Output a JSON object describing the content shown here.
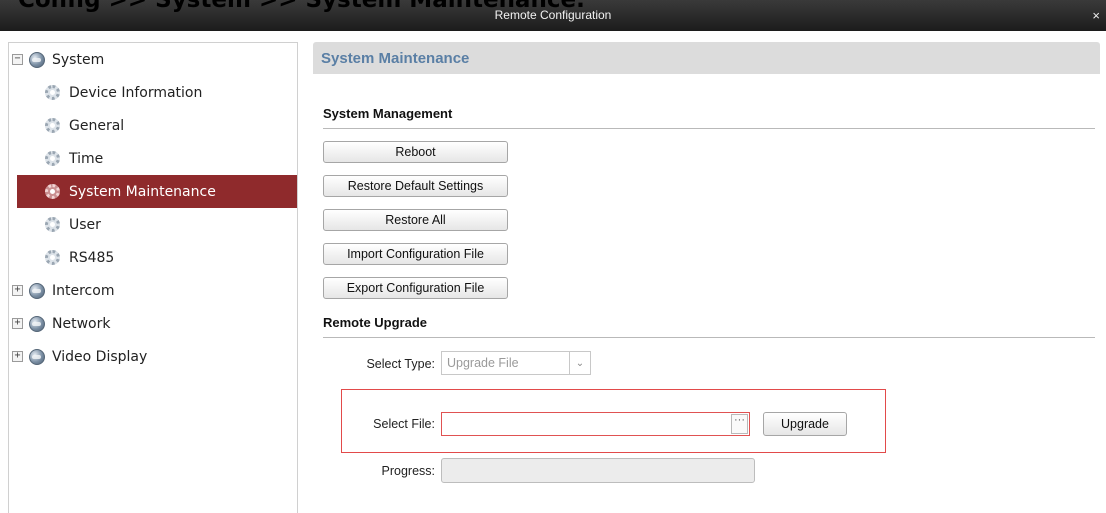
{
  "caption": "Config >> System >> System Maintenance.",
  "window": {
    "title": "Remote Configuration",
    "close_glyph": "×"
  },
  "sidebar": {
    "items": [
      {
        "label": "System",
        "level": 0,
        "toggle": "−",
        "icon": "globe-icon"
      },
      {
        "label": "Device Information",
        "level": 1,
        "icon": "gear-icon"
      },
      {
        "label": "General",
        "level": 1,
        "icon": "gear-icon"
      },
      {
        "label": "Time",
        "level": 1,
        "icon": "gear-icon"
      },
      {
        "label": "System Maintenance",
        "level": 1,
        "icon": "gear-icon",
        "selected": true
      },
      {
        "label": "User",
        "level": 1,
        "icon": "gear-icon"
      },
      {
        "label": "RS485",
        "level": 1,
        "icon": "gear-icon"
      },
      {
        "label": "Intercom",
        "level": 0,
        "toggle": "+",
        "icon": "globe-icon"
      },
      {
        "label": "Network",
        "level": 0,
        "toggle": "+",
        "icon": "globe-icon"
      },
      {
        "label": "Video Display",
        "level": 0,
        "toggle": "+",
        "icon": "globe-icon"
      }
    ]
  },
  "main": {
    "section_title": "System Maintenance",
    "system_management": {
      "title": "System Management",
      "buttons": [
        "Reboot",
        "Restore Default Settings",
        "Restore All",
        "Import Configuration File",
        "Export Configuration File"
      ]
    },
    "remote_upgrade": {
      "title": "Remote Upgrade",
      "select_type_label": "Select Type:",
      "select_type_value": "Upgrade File",
      "select_file_label": "Select File:",
      "select_file_value": "",
      "browse_glyph": "···",
      "upgrade_label": "Upgrade",
      "progress_label": "Progress:",
      "progress_percent": 0
    }
  },
  "colors": {
    "selected_bg": "#8f2a2c",
    "section_title": "#5a7fa5",
    "highlight_border": "#e24a4a"
  }
}
